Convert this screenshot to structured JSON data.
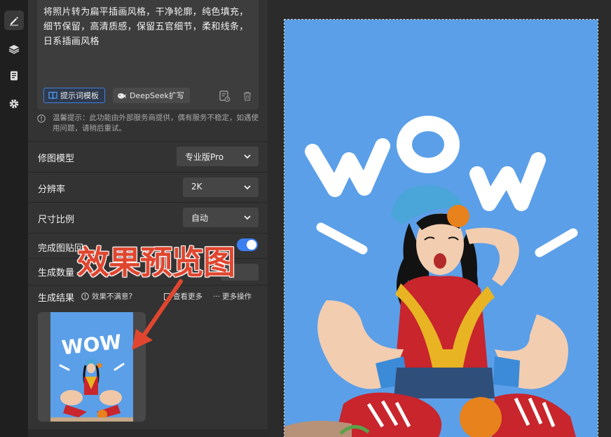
{
  "rail": {
    "items": [
      {
        "name": "edit",
        "icon": "pencil-icon",
        "active": true
      },
      {
        "name": "layers",
        "icon": "layers-icon",
        "active": false
      },
      {
        "name": "history",
        "icon": "document-icon",
        "active": false
      },
      {
        "name": "settings",
        "icon": "gear-icon",
        "active": false
      }
    ]
  },
  "prompt": {
    "text": "将照片转为扁平插画风格，干净轮廓，纯色填充，细节保留，高清质感，保留五官细节，柔和线条，日系插画风格",
    "template_button": "提示词模板",
    "deepseek_button": "DeepSeek扩写"
  },
  "tip": {
    "text": "温馨提示：此功能由外部服务商提供，偶有服务不稳定，如遇使用问题，请稍后重试。"
  },
  "settings": {
    "model_label": "修图模型",
    "model_value": "专业版Pro",
    "resolution_label": "分辨率",
    "resolution_value": "2K",
    "ratio_label": "尺寸比例",
    "ratio_value": "自动",
    "paste_label": "完成图贴回",
    "count_label": "生成数量"
  },
  "results": {
    "label": "生成结果",
    "unsatisfied": "效果不满意?",
    "view_more": "查看更多",
    "more_ops": "更多操作"
  },
  "annotation": {
    "text": "效果预览图"
  },
  "artwork": {
    "word": "WOW",
    "background": "#5b9fe8"
  },
  "colors": {
    "accent": "#3c7ff0",
    "annotation": "#e0462f"
  }
}
